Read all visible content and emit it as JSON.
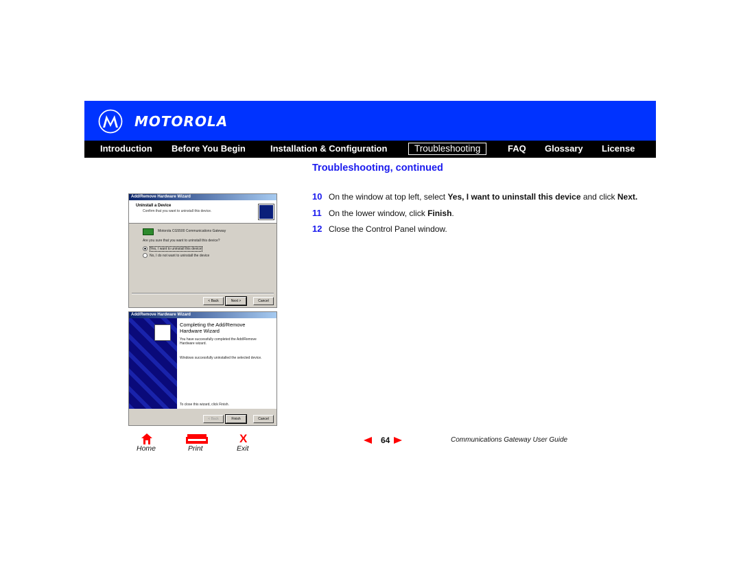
{
  "brand": {
    "name": "MOTOROLA",
    "logo_icon": "motorola-batwing-logo",
    "banner_color": "#0033ff"
  },
  "nav": {
    "items": [
      {
        "label": "Introduction",
        "active": false
      },
      {
        "label": "Before You Begin",
        "active": false
      },
      {
        "label": "Installation & Configuration",
        "active": false
      },
      {
        "label": "Troubleshooting",
        "active": true
      },
      {
        "label": "FAQ",
        "active": false
      },
      {
        "label": "Glossary",
        "active": false
      },
      {
        "label": "License",
        "active": false
      }
    ]
  },
  "section_title": "Troubleshooting, continued",
  "steps": [
    {
      "num": "10",
      "pre": "On the window at top left, select ",
      "bold1": "Yes, I want to uninstall this device",
      "mid": " and click ",
      "bold2": "Next.",
      "post": ""
    },
    {
      "num": "11",
      "pre": "On the lower window, click ",
      "bold1": "Finish",
      "mid": ".",
      "bold2": "",
      "post": ""
    },
    {
      "num": "12",
      "pre": "Close the Control Panel window.",
      "bold1": "",
      "mid": "",
      "bold2": "",
      "post": ""
    }
  ],
  "dialog1": {
    "title": "Add/Remove Hardware Wizard",
    "heading": "Uninstall a Device",
    "subheading": "Confirm that you want to uninstall this device.",
    "device": "Motorola CG5500 Communications Gateway",
    "question": "Are you sure that you want to uninstall this device?",
    "option_yes": "Yes, I want to uninstall this device",
    "option_no": "No, I do not want to uninstall the device",
    "btn_back": "< Back",
    "btn_next": "Next >",
    "btn_cancel": "Cancel"
  },
  "dialog2": {
    "title": "Add/Remove Hardware Wizard",
    "heading": "Completing the Add/Remove Hardware Wizard",
    "line1": "You have successfully completed the Add/Remove Hardware wizard.",
    "line2": "Windows successfully uninstalled the selected device.",
    "line3": "To close this wizard, click Finish.",
    "btn_back": "< Back",
    "btn_finish": "Finish",
    "btn_cancel": "Cancel"
  },
  "footer": {
    "home": "Home",
    "print": "Print",
    "exit": "Exit",
    "exit_glyph": "X",
    "page": "64",
    "guide_title": "Communications Gateway User Guide"
  }
}
